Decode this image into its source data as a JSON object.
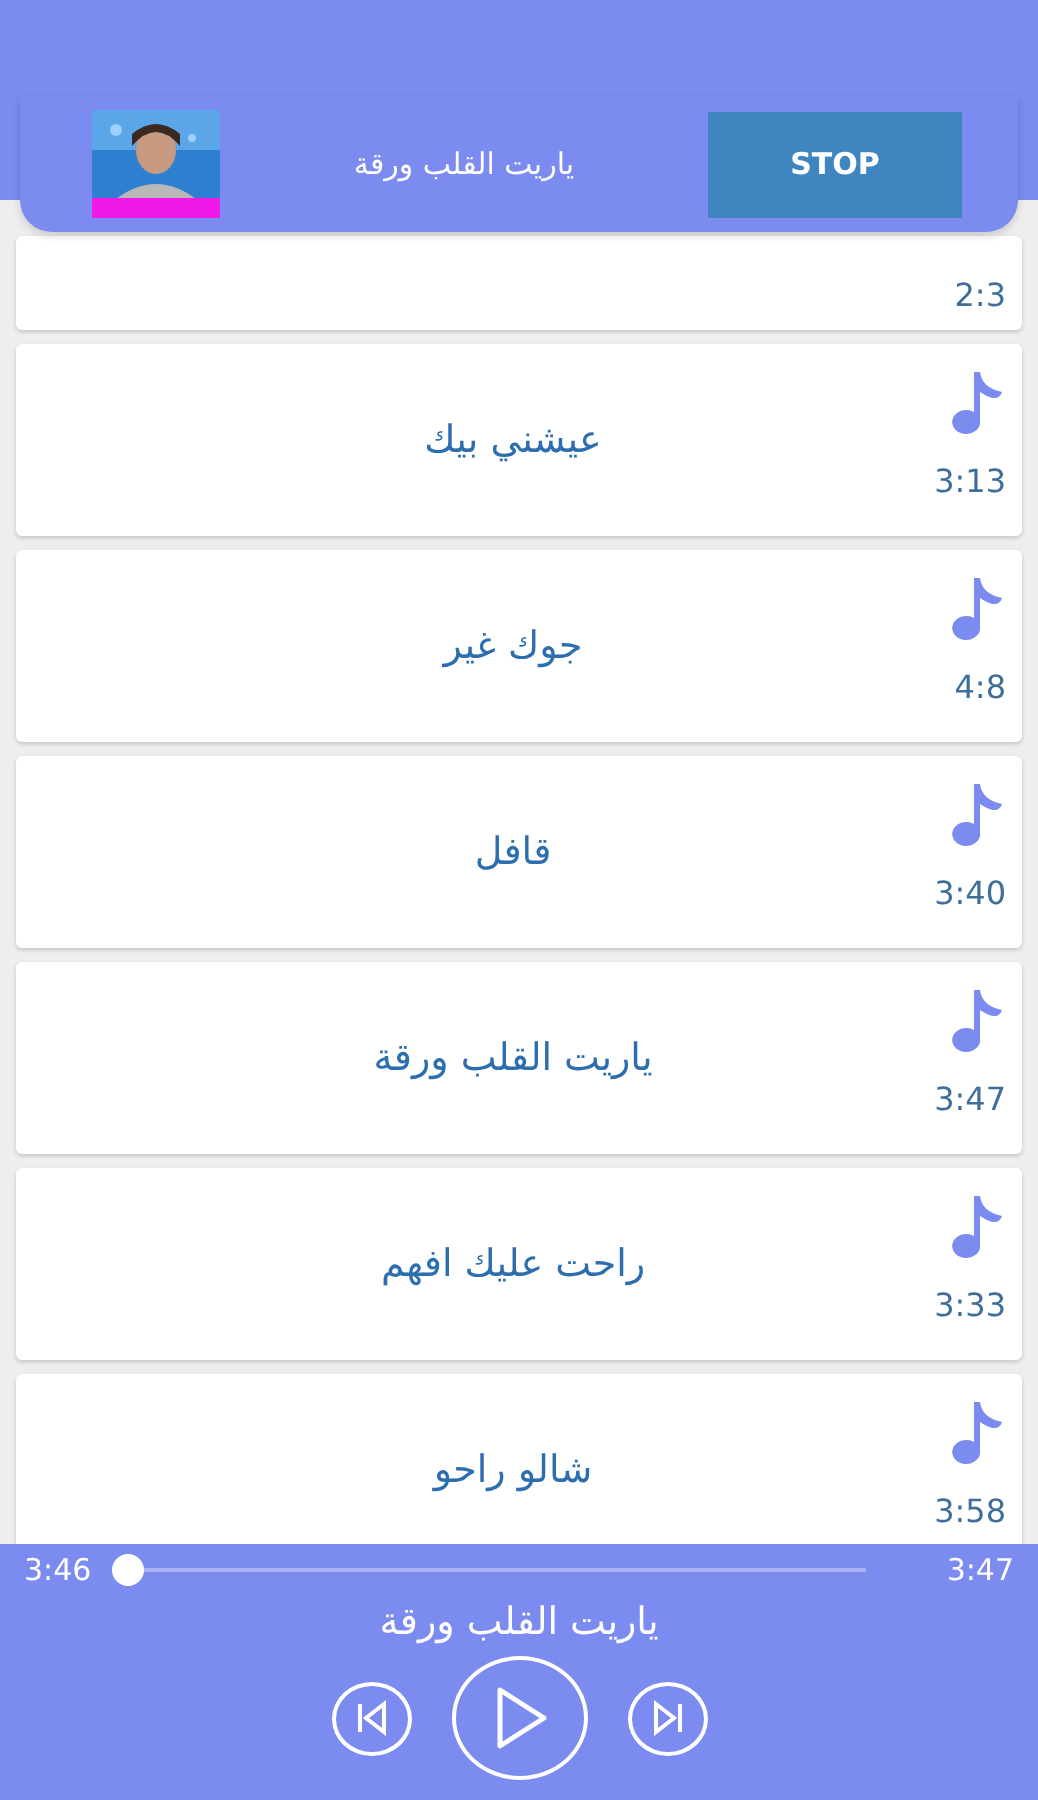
{
  "now_playing_banner": {
    "kind": "picture",
    "title": "ياريت القلب ورقة",
    "button": "STOP"
  },
  "songs": [
    {
      "duration": "2:3"
    },
    {
      "title": "عيشني بيك",
      "duration": "3:13"
    },
    {
      "title": "جوك غير",
      "duration": "4:8"
    },
    {
      "title": "قافل",
      "duration": "3:40"
    },
    {
      "title": "ياريت القلب ورقة",
      "duration": "3:47"
    },
    {
      "title": "راحت عليك افهم",
      "duration": "3:33"
    },
    {
      "title": "شالو راحو",
      "duration": "3:58"
    }
  ],
  "player": {
    "elapsed": "3:46",
    "total": "3:47",
    "level": 0.0,
    "title": "ياريت القلب ورقة"
  }
}
